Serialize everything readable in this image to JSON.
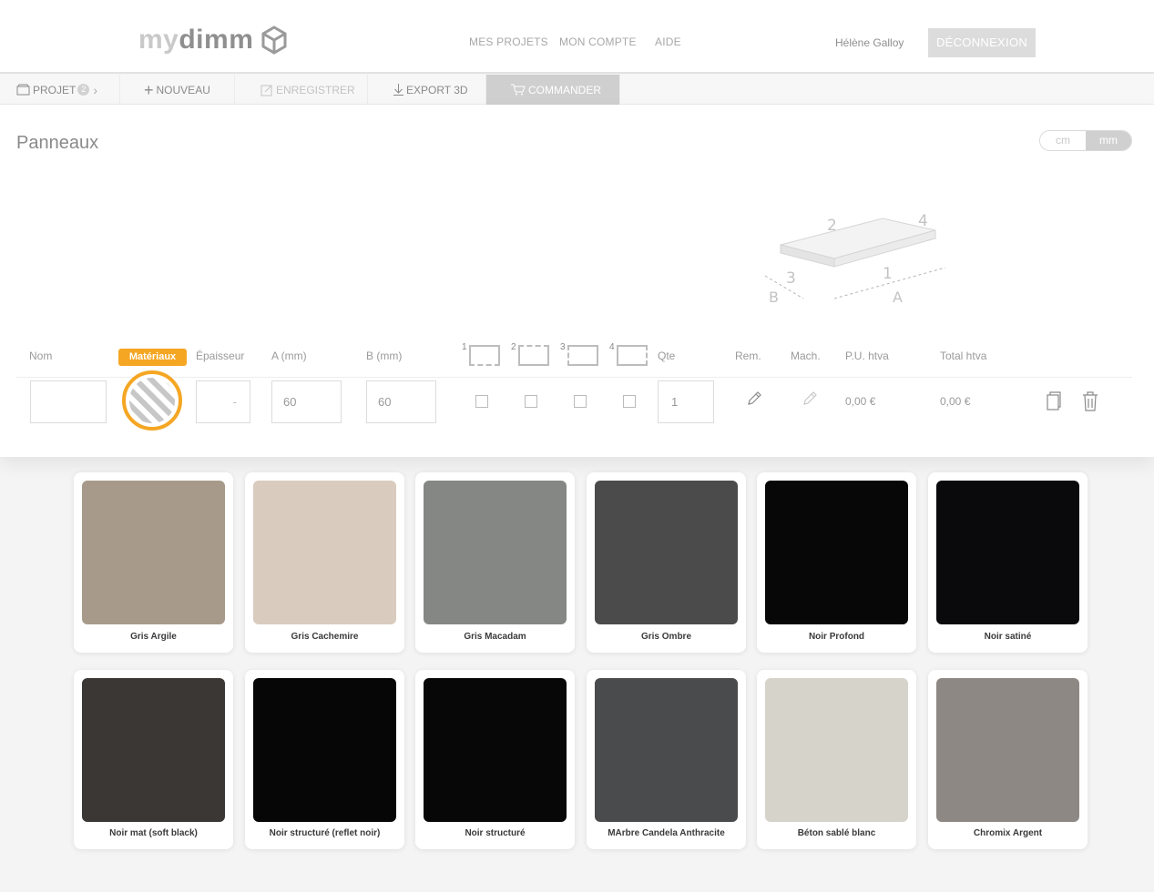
{
  "header": {
    "logo_my": "my",
    "logo_dimm": "dimm",
    "nav": [
      "MES PROJETS",
      "MON COMPTE",
      "AIDE"
    ],
    "user_name": "Hélène Galloy",
    "logout_label": "DÉCONNEXION"
  },
  "toolbar": {
    "projet_label": "PROJET",
    "projet_count": "2",
    "nouveau_label": "NOUVEAU",
    "enregistrer_label": "ENREGISTRER",
    "export_label": "EXPORT 3D",
    "commander_label": "COMMANDER"
  },
  "panel": {
    "title": "Panneaux",
    "unit_cm": "cm",
    "unit_mm": "mm",
    "diagram_labels": {
      "e1": "1",
      "e2": "2",
      "e3": "3",
      "e4": "4",
      "a": "A",
      "b": "B"
    }
  },
  "columns": {
    "nom": "Nom",
    "materiaux": "Matériaux",
    "epaisseur": "Épaisseur",
    "a": "A (mm)",
    "b": "B (mm)",
    "edge1": "1",
    "edge2": "2",
    "edge3": "3",
    "edge4": "4",
    "qte": "Qte",
    "rem": "Rem.",
    "mach": "Mach.",
    "pu": "P.U. htva",
    "total": "Total htva"
  },
  "row": {
    "nom": "",
    "epaisseur": "-",
    "a": "60",
    "b": "60",
    "qte": "1",
    "pu": "0,00 €",
    "total": "0,00 €"
  },
  "materials": [
    {
      "name": "Gris Argile",
      "color": "#a89a8a"
    },
    {
      "name": "Gris Cachemire",
      "color": "#d9cbbd"
    },
    {
      "name": "Gris Macadam",
      "color": "#858784"
    },
    {
      "name": "Gris Ombre",
      "color": "#4b4b4b"
    },
    {
      "name": "Noir Profond",
      "color": "#070708"
    },
    {
      "name": "Noir satiné",
      "color": "#0a0a0c"
    },
    {
      "name": "Noir mat (soft black)",
      "color": "#3b3734"
    },
    {
      "name": "Noir structuré (reflet noir)",
      "color": "#060606"
    },
    {
      "name": "Noir structuré",
      "color": "#070707"
    },
    {
      "name": "MArbre Candela Anthracite",
      "color": "#4a4b4d"
    },
    {
      "name": "Béton sablé blanc",
      "color": "#d6d3cb"
    },
    {
      "name": "Chromix Argent",
      "color": "#8e8884"
    }
  ]
}
